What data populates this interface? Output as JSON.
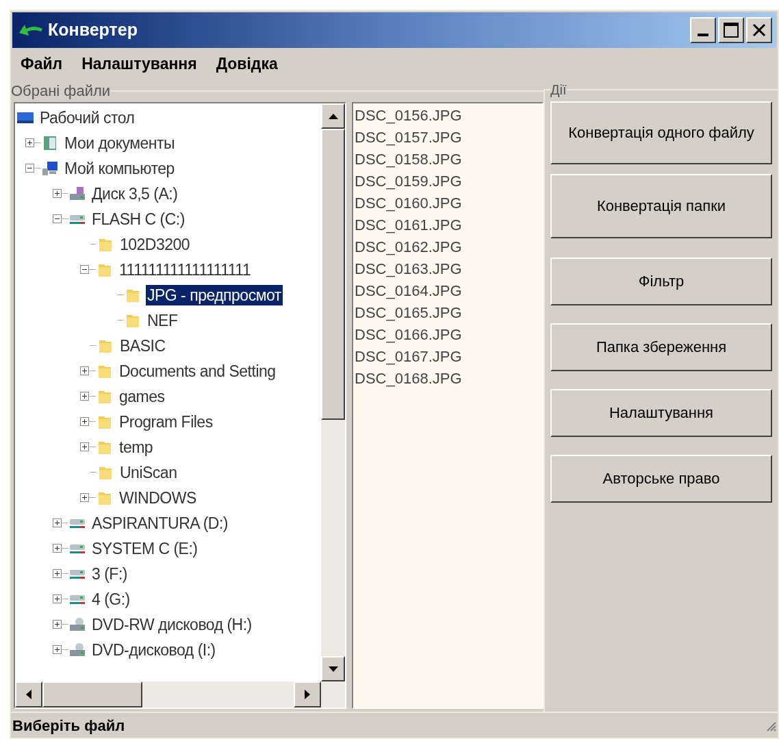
{
  "window": {
    "title": "Конвертер"
  },
  "menu": [
    "Файл",
    "Налаштування",
    "Довідка"
  ],
  "files_group": {
    "title": "Обрані файли"
  },
  "tree": [
    {
      "label": "Рабочий стол",
      "kind": "desktop",
      "selected": false,
      "children": [
        {
          "label": "Мои документы",
          "kind": "documents",
          "expanded": false,
          "selected": false
        },
        {
          "label": "Мой компьютер",
          "kind": "computer",
          "expanded": true,
          "selected": false,
          "children": [
            {
              "label": "Диск 3,5 (A:)",
              "kind": "floppy",
              "expanded": false,
              "selected": false
            },
            {
              "label": "FLASH C (C:)",
              "kind": "drive",
              "expanded": true,
              "selected": false,
              "children": [
                {
                  "label": "102D3200",
                  "kind": "folder",
                  "selected": false
                },
                {
                  "label": "111111111111111111",
                  "kind": "folder",
                  "expanded": true,
                  "selected": false,
                  "children": [
                    {
                      "label": "JPG - предпросмот",
                      "kind": "folder",
                      "selected": true
                    },
                    {
                      "label": "NEF",
                      "kind": "folder",
                      "selected": false
                    }
                  ]
                },
                {
                  "label": "BASIC",
                  "kind": "folder",
                  "selected": false
                },
                {
                  "label": "Documents and Setting",
                  "kind": "folder",
                  "expanded": false,
                  "selected": false
                },
                {
                  "label": "games",
                  "kind": "folder",
                  "expanded": false,
                  "selected": false
                },
                {
                  "label": "Program Files",
                  "kind": "folder",
                  "expanded": false,
                  "selected": false
                },
                {
                  "label": "temp",
                  "kind": "folder",
                  "expanded": false,
                  "selected": false
                },
                {
                  "label": "UniScan",
                  "kind": "folder",
                  "selected": false
                },
                {
                  "label": "WINDOWS",
                  "kind": "folder",
                  "expanded": false,
                  "selected": false
                }
              ]
            },
            {
              "label": "ASPIRANTURA (D:)",
              "kind": "drive",
              "expanded": false,
              "selected": false
            },
            {
              "label": "SYSTEM C (E:)",
              "kind": "drive",
              "expanded": false,
              "selected": false
            },
            {
              "label": "3 (F:)",
              "kind": "drive",
              "expanded": false,
              "selected": false
            },
            {
              "label": "4 (G:)",
              "kind": "drive",
              "expanded": false,
              "selected": false
            },
            {
              "label": "DVD-RW дисковод (H:)",
              "kind": "dvd",
              "expanded": false,
              "selected": false
            },
            {
              "label": "DVD-дисковод (I:)",
              "kind": "dvd",
              "expanded": false,
              "selected": false
            }
          ]
        }
      ]
    }
  ],
  "file_list": [
    "DSC_0156.JPG",
    "DSC_0157.JPG",
    "DSC_0158.JPG",
    "DSC_0159.JPG",
    "DSC_0160.JPG",
    "DSC_0161.JPG",
    "DSC_0162.JPG",
    "DSC_0163.JPG",
    "DSC_0164.JPG",
    "DSC_0165.JPG",
    "DSC_0166.JPG",
    "DSC_0167.JPG",
    "DSC_0168.JPG"
  ],
  "actions_group": {
    "title": "Дії",
    "buttons": [
      "Конвертація одного файлу",
      "Конвертація папки",
      "Фільтр",
      "Папка збереження",
      "Налаштування",
      "Авторське право"
    ]
  },
  "status_bar": "Виберіть файл"
}
